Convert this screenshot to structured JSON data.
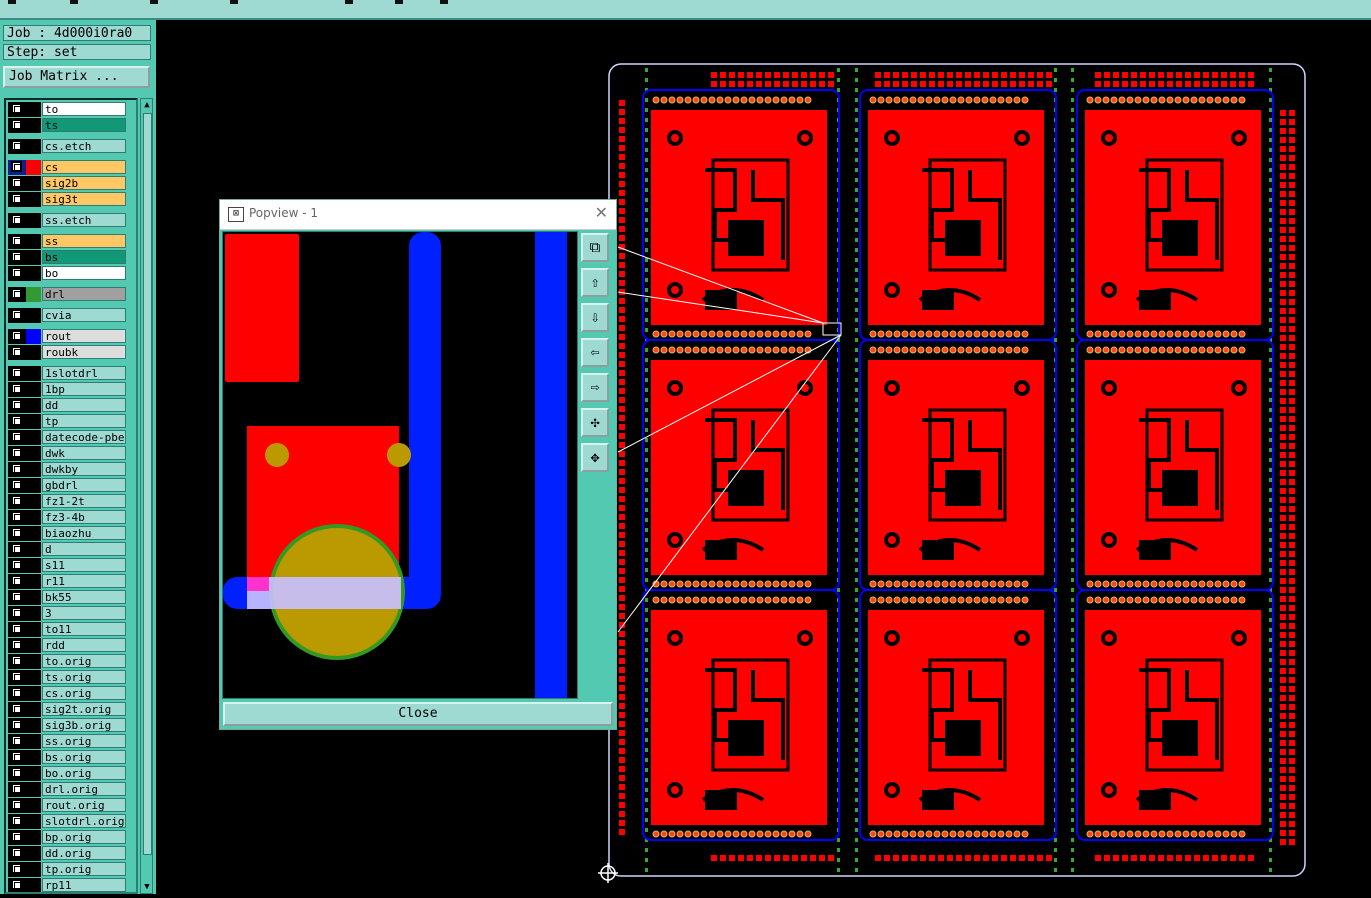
{
  "job_label": "Job : 4d000i0ra0",
  "step_label": "Step: set",
  "job_matrix_button": "Job Matrix ...",
  "colors": {
    "panel_bg": "#52c9b0",
    "panel_light": "#9ed9d2",
    "copper": "#ff0000",
    "rout": "#0000ff",
    "yellow_layer": "#ffc864",
    "green_layer": "#119977"
  },
  "layers": [
    {
      "name": "to",
      "color": "#ffffff",
      "swatch": "#000000",
      "gap": false
    },
    {
      "name": "ts",
      "color": "#119977",
      "swatch": "#000000",
      "gap": false
    },
    {
      "name": "cs.etch",
      "color": "#9ed9d2",
      "swatch": "#000000",
      "gap": true
    },
    {
      "name": "cs",
      "color": "#ffc864",
      "swatch": "#ff0000",
      "gap": true,
      "active": true
    },
    {
      "name": "sig2b",
      "color": "#ffc864",
      "swatch": "#000000",
      "gap": false
    },
    {
      "name": "sig3t",
      "color": "#ffc864",
      "swatch": "#000000",
      "gap": false
    },
    {
      "name": "ss.etch",
      "color": "#9ed9d2",
      "swatch": "#000000",
      "gap": true
    },
    {
      "name": "ss",
      "color": "#ffc864",
      "swatch": "#000000",
      "gap": true
    },
    {
      "name": "bs",
      "color": "#119977",
      "swatch": "#000000",
      "gap": false
    },
    {
      "name": "bo",
      "color": "#ffffff",
      "swatch": "#000000",
      "gap": false
    },
    {
      "name": "drl",
      "color": "#a0a0a0",
      "swatch": "#339933",
      "gap": true
    },
    {
      "name": "cvia",
      "color": "#9ed9d2",
      "swatch": "#000000",
      "gap": true
    },
    {
      "name": "rout",
      "color": "#dddddd",
      "swatch": "#0000ff",
      "gap": true
    },
    {
      "name": "roubk",
      "color": "#dddddd",
      "swatch": "#000000",
      "gap": false
    },
    {
      "name": "1slotdrl",
      "color": "#9ed9d2",
      "swatch": "#000000",
      "gap": true
    },
    {
      "name": "1bp",
      "color": "#9ed9d2",
      "swatch": "#000000",
      "gap": false
    },
    {
      "name": "dd",
      "color": "#9ed9d2",
      "swatch": "#000000",
      "gap": false
    },
    {
      "name": "tp",
      "color": "#9ed9d2",
      "swatch": "#000000",
      "gap": false
    },
    {
      "name": "datecode-pbe",
      "color": "#9ed9d2",
      "swatch": "#000000",
      "gap": false
    },
    {
      "name": "dwk",
      "color": "#9ed9d2",
      "swatch": "#000000",
      "gap": false
    },
    {
      "name": "dwkby",
      "color": "#9ed9d2",
      "swatch": "#000000",
      "gap": false
    },
    {
      "name": "gbdrl",
      "color": "#9ed9d2",
      "swatch": "#000000",
      "gap": false
    },
    {
      "name": "fz1-2t",
      "color": "#9ed9d2",
      "swatch": "#000000",
      "gap": false
    },
    {
      "name": "fz3-4b",
      "color": "#9ed9d2",
      "swatch": "#000000",
      "gap": false
    },
    {
      "name": "biaozhu",
      "color": "#9ed9d2",
      "swatch": "#000000",
      "gap": false
    },
    {
      "name": "d",
      "color": "#9ed9d2",
      "swatch": "#000000",
      "gap": false
    },
    {
      "name": "s11",
      "color": "#9ed9d2",
      "swatch": "#000000",
      "gap": false
    },
    {
      "name": "r11",
      "color": "#9ed9d2",
      "swatch": "#000000",
      "gap": false
    },
    {
      "name": "bk55",
      "color": "#9ed9d2",
      "swatch": "#000000",
      "gap": false
    },
    {
      "name": "3",
      "color": "#9ed9d2",
      "swatch": "#000000",
      "gap": false
    },
    {
      "name": "to11",
      "color": "#9ed9d2",
      "swatch": "#000000",
      "gap": false
    },
    {
      "name": "rdd",
      "color": "#9ed9d2",
      "swatch": "#000000",
      "gap": false
    },
    {
      "name": "to.orig",
      "color": "#9ed9d2",
      "swatch": "#000000",
      "gap": false
    },
    {
      "name": "ts.orig",
      "color": "#9ed9d2",
      "swatch": "#000000",
      "gap": false
    },
    {
      "name": "cs.orig",
      "color": "#9ed9d2",
      "swatch": "#000000",
      "gap": false
    },
    {
      "name": "sig2t.orig",
      "color": "#9ed9d2",
      "swatch": "#000000",
      "gap": false
    },
    {
      "name": "sig3b.orig",
      "color": "#9ed9d2",
      "swatch": "#000000",
      "gap": false
    },
    {
      "name": "ss.orig",
      "color": "#9ed9d2",
      "swatch": "#000000",
      "gap": false
    },
    {
      "name": "bs.orig",
      "color": "#9ed9d2",
      "swatch": "#000000",
      "gap": false
    },
    {
      "name": "bo.orig",
      "color": "#9ed9d2",
      "swatch": "#000000",
      "gap": false
    },
    {
      "name": "drl.orig",
      "color": "#9ed9d2",
      "swatch": "#000000",
      "gap": false
    },
    {
      "name": "rout.orig",
      "color": "#9ed9d2",
      "swatch": "#000000",
      "gap": false
    },
    {
      "name": "slotdrl.orig",
      "color": "#9ed9d2",
      "swatch": "#000000",
      "gap": false
    },
    {
      "name": "bp.orig",
      "color": "#9ed9d2",
      "swatch": "#000000",
      "gap": false
    },
    {
      "name": "dd.orig",
      "color": "#9ed9d2",
      "swatch": "#000000",
      "gap": false
    },
    {
      "name": "tp.orig",
      "color": "#9ed9d2",
      "swatch": "#000000",
      "gap": false
    },
    {
      "name": "rp11",
      "color": "#9ed9d2",
      "swatch": "#000000",
      "gap": false
    }
  ],
  "popview": {
    "title": "Popview - 1",
    "close_label": "Close",
    "tools": [
      {
        "name": "zoom-fit-icon",
        "glyph": "⧉"
      },
      {
        "name": "pan-up-icon",
        "glyph": "⇧"
      },
      {
        "name": "pan-down-icon",
        "glyph": "⇩"
      },
      {
        "name": "pan-left-icon",
        "glyph": "⇦"
      },
      {
        "name": "pan-right-icon",
        "glyph": "⇨"
      },
      {
        "name": "zoom-out-icon",
        "glyph": "✣"
      },
      {
        "name": "zoom-in-icon",
        "glyph": "✥"
      }
    ]
  },
  "panel": {
    "rows": 3,
    "cols": 3
  }
}
